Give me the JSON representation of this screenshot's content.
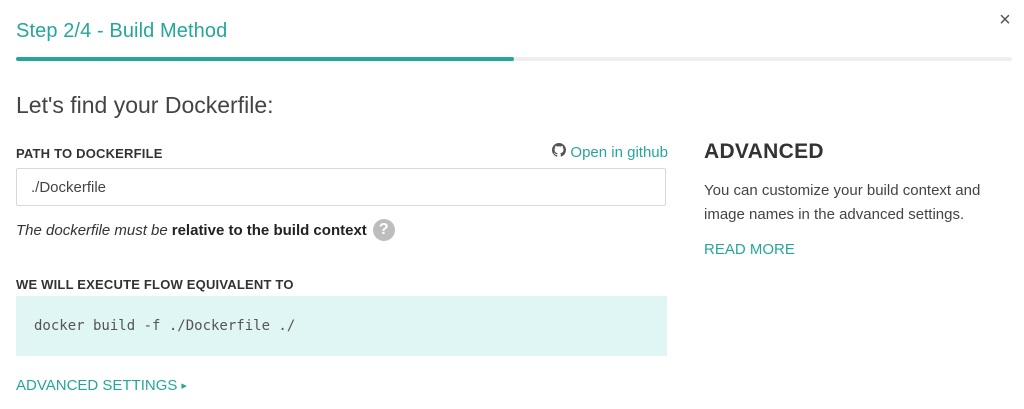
{
  "header": {
    "step_title": "Step 2/4 - Build Method",
    "close_glyph": "×",
    "progress_fraction": 0.5
  },
  "main": {
    "question": "Let's find your Dockerfile:",
    "path_label": "PATH TO DOCKERFILE",
    "github_link_label": "Open in github",
    "path_input_value": "./Dockerfile",
    "hint_italic": "The dockerfile must be",
    "hint_bold": "relative to the build context",
    "help_glyph": "?",
    "execute_label": "WE WILL EXECUTE FLOW EQUIVALENT TO",
    "command": "docker build -f ./Dockerfile ./",
    "advanced_settings_label": "ADVANCED SETTINGS",
    "caret_glyph": "▸"
  },
  "sidebar": {
    "title": "ADVANCED",
    "text": "You can customize your build context and image names in the advanced settings.",
    "read_more": "READ MORE"
  },
  "colors": {
    "accent": "#26a69a",
    "code_bg": "#dff6f4",
    "progress_track": "#eeeeee"
  },
  "icons": [
    "close-icon",
    "github-icon",
    "help-icon",
    "caret-right-icon"
  ]
}
